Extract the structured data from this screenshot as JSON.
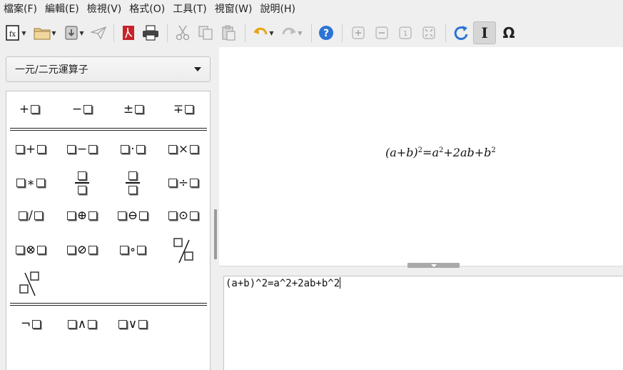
{
  "menu": [
    "檔案(F)",
    "編輯(E)",
    "檢視(V)",
    "格式(O)",
    "工具(T)",
    "視窗(W)",
    "說明(H)"
  ],
  "toolbar": {
    "icons": [
      "new-formula-icon",
      "open-folder-icon",
      "save-icon",
      "send-icon",
      "export-pdf-icon",
      "print-icon",
      "cut-icon",
      "copy-icon",
      "paste-icon",
      "undo-icon",
      "redo-icon",
      "help-icon",
      "zoom-in-icon",
      "zoom-out-icon",
      "actual-size-icon",
      "show-all-icon",
      "update-icon",
      "formula-cursor-icon",
      "symbols-icon"
    ],
    "symbols_glyph": "Ω",
    "cursor_glyph": "I",
    "help_glyph": "?",
    "actual_size_glyph": "1"
  },
  "elements_panel": {
    "category": "一元/二元運算子",
    "unary_ops": [
      "+",
      "−",
      "±",
      "∓"
    ],
    "binary_ops_row1": [
      "+",
      "−",
      "·",
      "×"
    ],
    "binary_ops_row2": [
      "∗",
      "",
      "",
      "÷"
    ],
    "binary_ops_row3": [
      "/",
      "⊕",
      "⊖",
      "⊙"
    ],
    "binary_ops_row4": [
      "⊗",
      "⊘",
      "∘",
      ""
    ],
    "logic_ops": [
      "¬",
      "∧",
      "∨"
    ]
  },
  "formula_display": {
    "lhs": "(a+b)",
    "lhs_exp": "2",
    "eq": "=",
    "t1": "a",
    "t1_exp": "2",
    "t2": "+2ab+b",
    "t2_exp": "2"
  },
  "editor": {
    "text": "(a+b)^2=a^2+2ab+b^2"
  },
  "colors": {
    "accent_blue": "#2b74d6",
    "pdf_red": "#c8222a",
    "undo_orange": "#e8a317"
  }
}
